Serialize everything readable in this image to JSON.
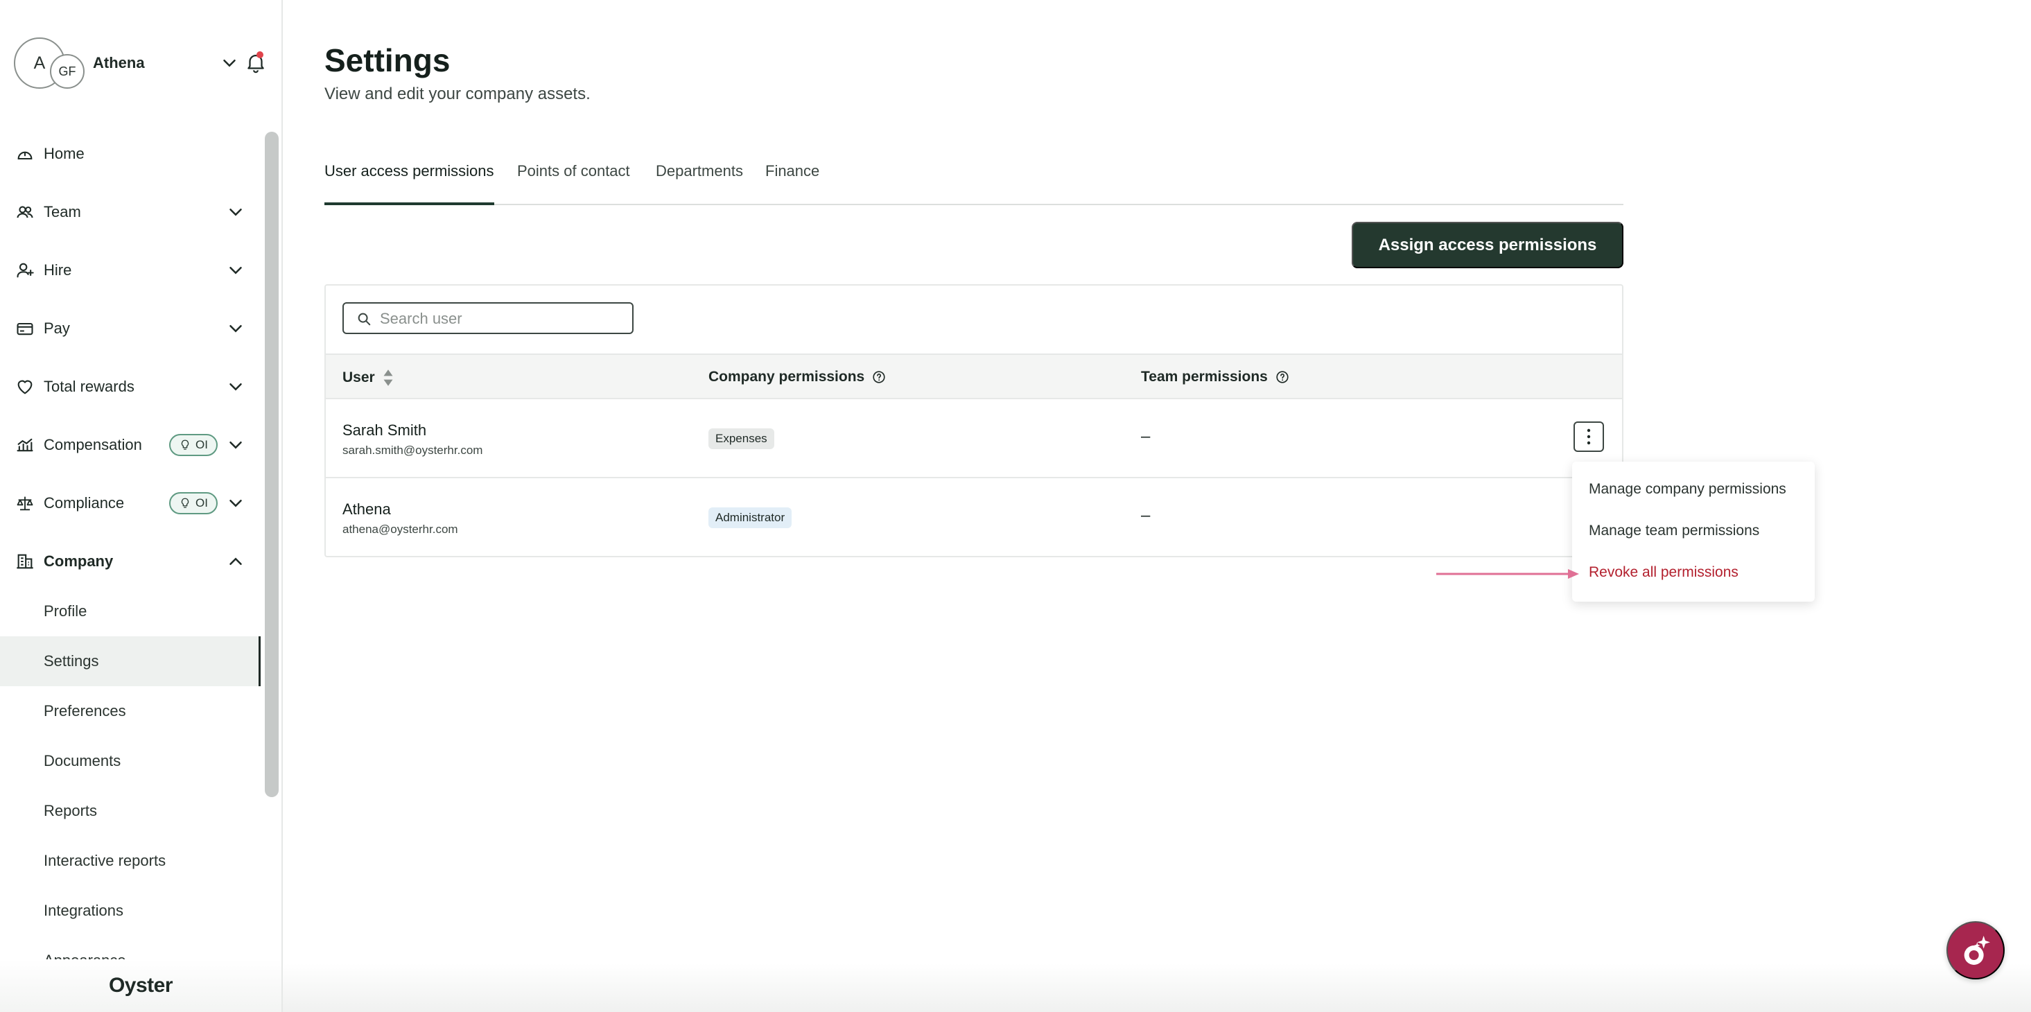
{
  "account": {
    "avatar_primary": "A",
    "avatar_secondary": "GF",
    "name": "Athena"
  },
  "sidebar": {
    "items": [
      {
        "label": "Home",
        "icon": "home-icon"
      },
      {
        "label": "Team",
        "icon": "team-icon"
      },
      {
        "label": "Hire",
        "icon": "hire-icon"
      },
      {
        "label": "Pay",
        "icon": "pay-icon"
      },
      {
        "label": "Total rewards",
        "icon": "heart-icon"
      },
      {
        "label": "Compensation",
        "icon": "compensation-icon",
        "badge": "OI"
      },
      {
        "label": "Compliance",
        "icon": "scales-icon",
        "badge": "OI"
      },
      {
        "label": "Company",
        "icon": "building-icon"
      }
    ],
    "company_sub_items": [
      {
        "label": "Profile"
      },
      {
        "label": "Settings",
        "active": true
      },
      {
        "label": "Preferences"
      },
      {
        "label": "Documents"
      },
      {
        "label": "Reports"
      },
      {
        "label": "Interactive reports"
      },
      {
        "label": "Integrations"
      },
      {
        "label": "Appearance"
      }
    ],
    "brand": "Oyster"
  },
  "page": {
    "title": "Settings",
    "subtitle": "View and edit your company assets."
  },
  "tabs": [
    {
      "label": "User access permissions",
      "active": true
    },
    {
      "label": "Points of contact"
    },
    {
      "label": "Departments"
    },
    {
      "label": "Finance"
    }
  ],
  "assign_button": "Assign access permissions",
  "search": {
    "placeholder": "Search user",
    "value": ""
  },
  "table": {
    "columns": [
      "User",
      "Company permissions",
      "Team permissions"
    ],
    "rows": [
      {
        "name": "Sarah Smith",
        "email": "sarah.smith@oysterhr.com",
        "company_permission": "Expenses",
        "team_permission": "–"
      },
      {
        "name": "Athena",
        "email": "athena@oysterhr.com",
        "company_permission": "Administrator",
        "team_permission": "–"
      }
    ]
  },
  "row_menu": {
    "items": [
      {
        "label": "Manage company permissions"
      },
      {
        "label": "Manage team permissions"
      },
      {
        "label": "Revoke all permissions",
        "danger": true
      }
    ]
  },
  "colors": {
    "primary_button": "#24392f",
    "danger_text": "#b3202e",
    "annotation_arrow": "#e07095",
    "help_fab": "#a7264f"
  }
}
